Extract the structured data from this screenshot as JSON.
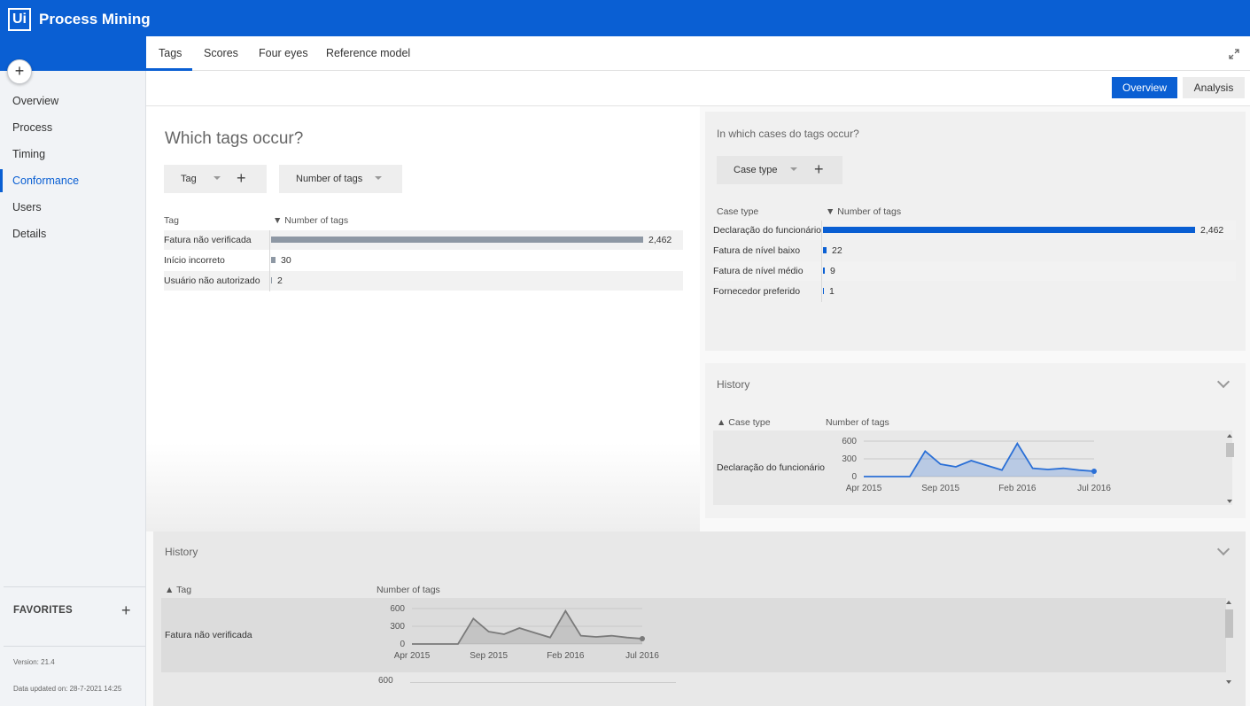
{
  "app": {
    "logo": "Ui",
    "title": "Process Mining"
  },
  "sidebar": {
    "add_label": "+",
    "items": [
      {
        "label": "Overview",
        "active": false
      },
      {
        "label": "Process",
        "active": false
      },
      {
        "label": "Timing",
        "active": false
      },
      {
        "label": "Conformance",
        "active": true
      },
      {
        "label": "Users",
        "active": false
      },
      {
        "label": "Details",
        "active": false
      }
    ],
    "favorites_label": "FAVORITES",
    "favorites_add": "+",
    "version": "Version: 21.4",
    "data_updated": "Data updated on: 28-7-2021 14:25"
  },
  "tabs": [
    {
      "label": "Tags",
      "active": true
    },
    {
      "label": "Scores",
      "active": false
    },
    {
      "label": "Four eyes",
      "active": false
    },
    {
      "label": "Reference model",
      "active": false
    }
  ],
  "toolbar": {
    "overview_label": "Overview",
    "analysis_label": "Analysis"
  },
  "tags_panel": {
    "title": "Which tags occur?",
    "chip_tag": "Tag",
    "chip_metric": "Number of tags",
    "col_tag": "Tag",
    "col_metric": "▼ Number of tags",
    "rows": [
      {
        "name": "Fatura não verificada",
        "value": 2462,
        "display": "2,462"
      },
      {
        "name": "Início incorreto",
        "value": 30,
        "display": "30"
      },
      {
        "name": "Usuário não autorizado",
        "value": 2,
        "display": "2"
      }
    ]
  },
  "cases_panel": {
    "title": "In which cases do tags occur?",
    "chip_case": "Case type",
    "col_case": "Case type",
    "col_metric": "▼ Number of tags",
    "rows": [
      {
        "name": "Declaração do funcionário",
        "value": 2462,
        "display": "2,462"
      },
      {
        "name": "Fatura de nível baixo",
        "value": 22,
        "display": "22"
      },
      {
        "name": "Fatura de nível médio",
        "value": 9,
        "display": "9"
      },
      {
        "name": "Fornecedor preferido",
        "value": 1,
        "display": "1"
      }
    ]
  },
  "history_right": {
    "title": "History",
    "col_case": "▲ Case type",
    "col_metric": "Number of tags",
    "row_label": "Declaração do funcionário"
  },
  "history_bottom": {
    "title": "History",
    "col_tag": "▲ Tag",
    "col_metric": "Number of tags",
    "row_label": "Fatura não verificada",
    "next_tick": "600"
  },
  "chart_data": [
    {
      "type": "area",
      "x": [
        "Apr 2015",
        "May 2015",
        "Jun 2015",
        "Jul 2015",
        "Aug 2015",
        "Sep 2015",
        "Oct 2015",
        "Nov 2015",
        "Dec 2015",
        "Jan 2016",
        "Feb 2016",
        "Mar 2016",
        "Apr 2016",
        "May 2016",
        "Jun 2016",
        "Jul 2016"
      ],
      "series": [
        {
          "values": [
            0,
            0,
            0,
            0,
            430,
            210,
            165,
            270,
            190,
            110,
            560,
            140,
            120,
            140,
            110,
            90
          ]
        }
      ],
      "x_tick_labels": [
        "Apr 2015",
        "Sep 2015",
        "Feb 2016",
        "Jul 2016"
      ],
      "y_ticks": [
        "600",
        "300",
        "0"
      ],
      "ylim": [
        0,
        600
      ],
      "grid": true,
      "color": "#2a6fd6"
    },
    {
      "type": "area",
      "x": [
        "Apr 2015",
        "May 2015",
        "Jun 2015",
        "Jul 2015",
        "Aug 2015",
        "Sep 2015",
        "Oct 2015",
        "Nov 2015",
        "Dec 2015",
        "Jan 2016",
        "Feb 2016",
        "Mar 2016",
        "Apr 2016",
        "May 2016",
        "Jun 2016",
        "Jul 2016"
      ],
      "series": [
        {
          "values": [
            0,
            0,
            0,
            0,
            430,
            210,
            165,
            270,
            190,
            110,
            560,
            140,
            120,
            140,
            110,
            90
          ]
        }
      ],
      "x_tick_labels": [
        "Apr 2015",
        "Sep 2015",
        "Feb 2016",
        "Jul 2016"
      ],
      "y_ticks": [
        "600",
        "300",
        "0"
      ],
      "ylim": [
        0,
        600
      ],
      "grid": true,
      "color": "#7a7a7a"
    }
  ]
}
